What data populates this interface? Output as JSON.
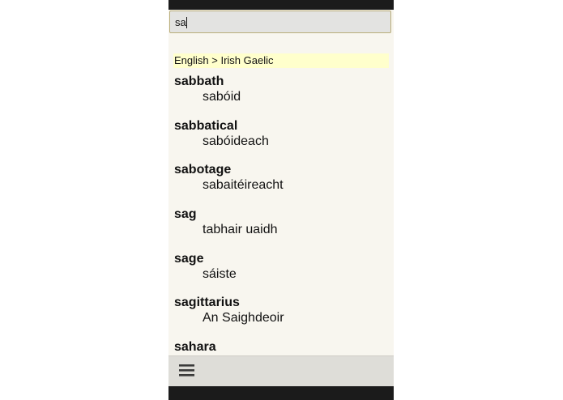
{
  "search": {
    "value": "sa",
    "placeholder": ""
  },
  "results": {
    "language_header": "English > Irish Gaelic",
    "entries": [
      {
        "term": "sabbath",
        "translation": "sabóid"
      },
      {
        "term": "sabbatical",
        "translation": "sabóideach"
      },
      {
        "term": "sabotage",
        "translation": "sabaitéireacht"
      },
      {
        "term": "sag",
        "translation": "tabhair uaidh"
      },
      {
        "term": "sage",
        "translation": "sáiste"
      },
      {
        "term": "sagittarius",
        "translation": "An Saighdeoir"
      },
      {
        "term": "sahara",
        "translation": ""
      }
    ]
  },
  "bottom_bar": {
    "menu_icon": "hamburger-menu-icon"
  },
  "colors": {
    "screen_background": "#f8f6ef",
    "header_highlight": "#ffffcc",
    "search_border": "#b9ad7a",
    "device_frame": "#1b1b1b",
    "bottom_bar": "#deddd8"
  }
}
